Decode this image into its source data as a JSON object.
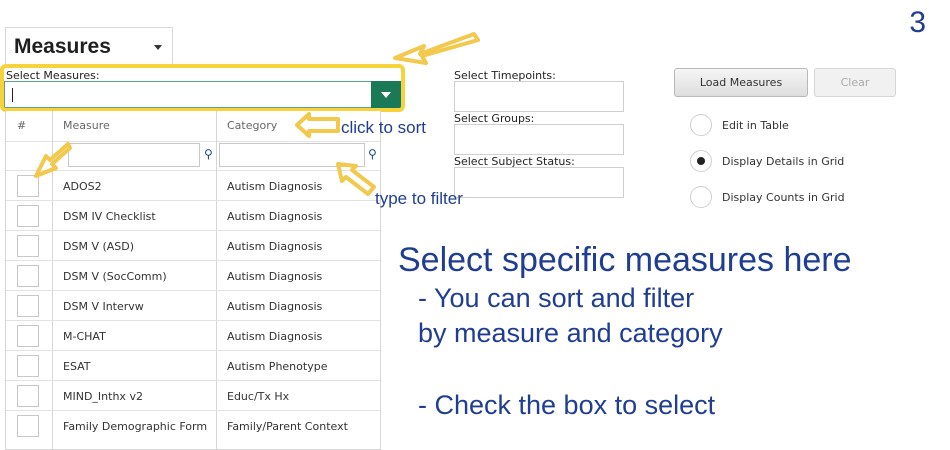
{
  "page_number": "3",
  "measures_menu": {
    "title": "Measures"
  },
  "select_measures": {
    "label": "Select Measures:",
    "value": ""
  },
  "table": {
    "headers": [
      "#",
      "Measure",
      "Category"
    ],
    "rows": [
      {
        "measure": "ADOS2",
        "category": "Autism Diagnosis"
      },
      {
        "measure": "DSM IV Checklist",
        "category": "Autism Diagnosis"
      },
      {
        "measure": "DSM V (ASD)",
        "category": "Autism Diagnosis"
      },
      {
        "measure": "DSM V (SocComm)",
        "category": "Autism Diagnosis"
      },
      {
        "measure": "DSM V Intervw",
        "category": "Autism Diagnosis"
      },
      {
        "measure": "M-CHAT",
        "category": "Autism Diagnosis"
      },
      {
        "measure": "ESAT",
        "category": "Autism Phenotype"
      },
      {
        "measure": "MIND_Inthx v2",
        "category": "Educ/Tx Hx"
      },
      {
        "measure": "Family Demographic Form",
        "category": "Family/Parent Context"
      }
    ]
  },
  "middle": {
    "timepoints_label": "Select Timepoints:",
    "groups_label": "Select Groups:",
    "status_label": "Select Subject Status:"
  },
  "buttons": {
    "load": "Load Measures",
    "clear": "Clear"
  },
  "display_options": [
    {
      "label": "Edit in Table",
      "selected": false
    },
    {
      "label": "Display Details in Grid",
      "selected": true
    },
    {
      "label": "Display Counts in Grid",
      "selected": false
    }
  ],
  "annotations": {
    "click_to_sort": "click to sort",
    "type_to_filter": "type to filter",
    "line1": "Select specific measures here",
    "line2": "- You can sort and filter",
    "line3": "by measure and category",
    "line4": "- Check the box to select"
  },
  "colors": {
    "annotation_text": "#1f3d93",
    "highlight": "#f6d23d",
    "dropdown_button": "#1a7a57",
    "filter_icon": "#1e4b7c"
  }
}
